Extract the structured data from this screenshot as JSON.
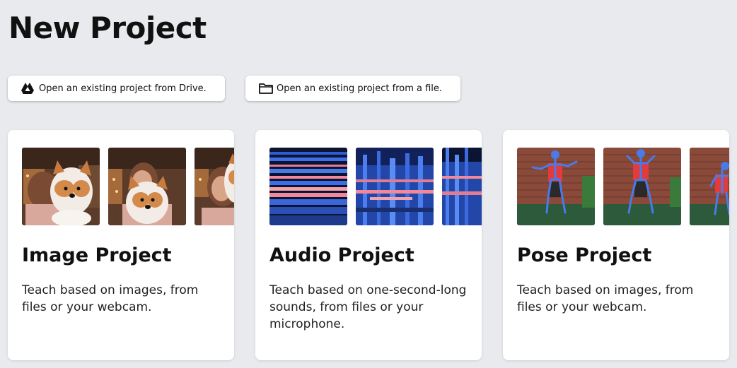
{
  "page": {
    "title": "New Project"
  },
  "buttons": {
    "drive": {
      "label": "Open an existing project from Drive.",
      "icon": "google-drive-icon"
    },
    "file": {
      "label": "Open an existing project from a file.",
      "icon": "folder-icon"
    }
  },
  "cards": [
    {
      "title": "Image Project",
      "description": "Teach based on images, from files or your webcam."
    },
    {
      "title": "Audio Project",
      "description": "Teach based on one-second-long sounds, from files or your microphone."
    },
    {
      "title": "Pose Project",
      "description": "Teach based on images, from files or your webcam."
    }
  ],
  "colors": {
    "background": "#e8eaed",
    "card": "#ffffff",
    "pose_skeleton": "#4a7ae8",
    "pose_shirt": "#e23b3b",
    "spectrogram_dark": "#0b1433",
    "spectrogram_hot": "#f08a9a"
  }
}
